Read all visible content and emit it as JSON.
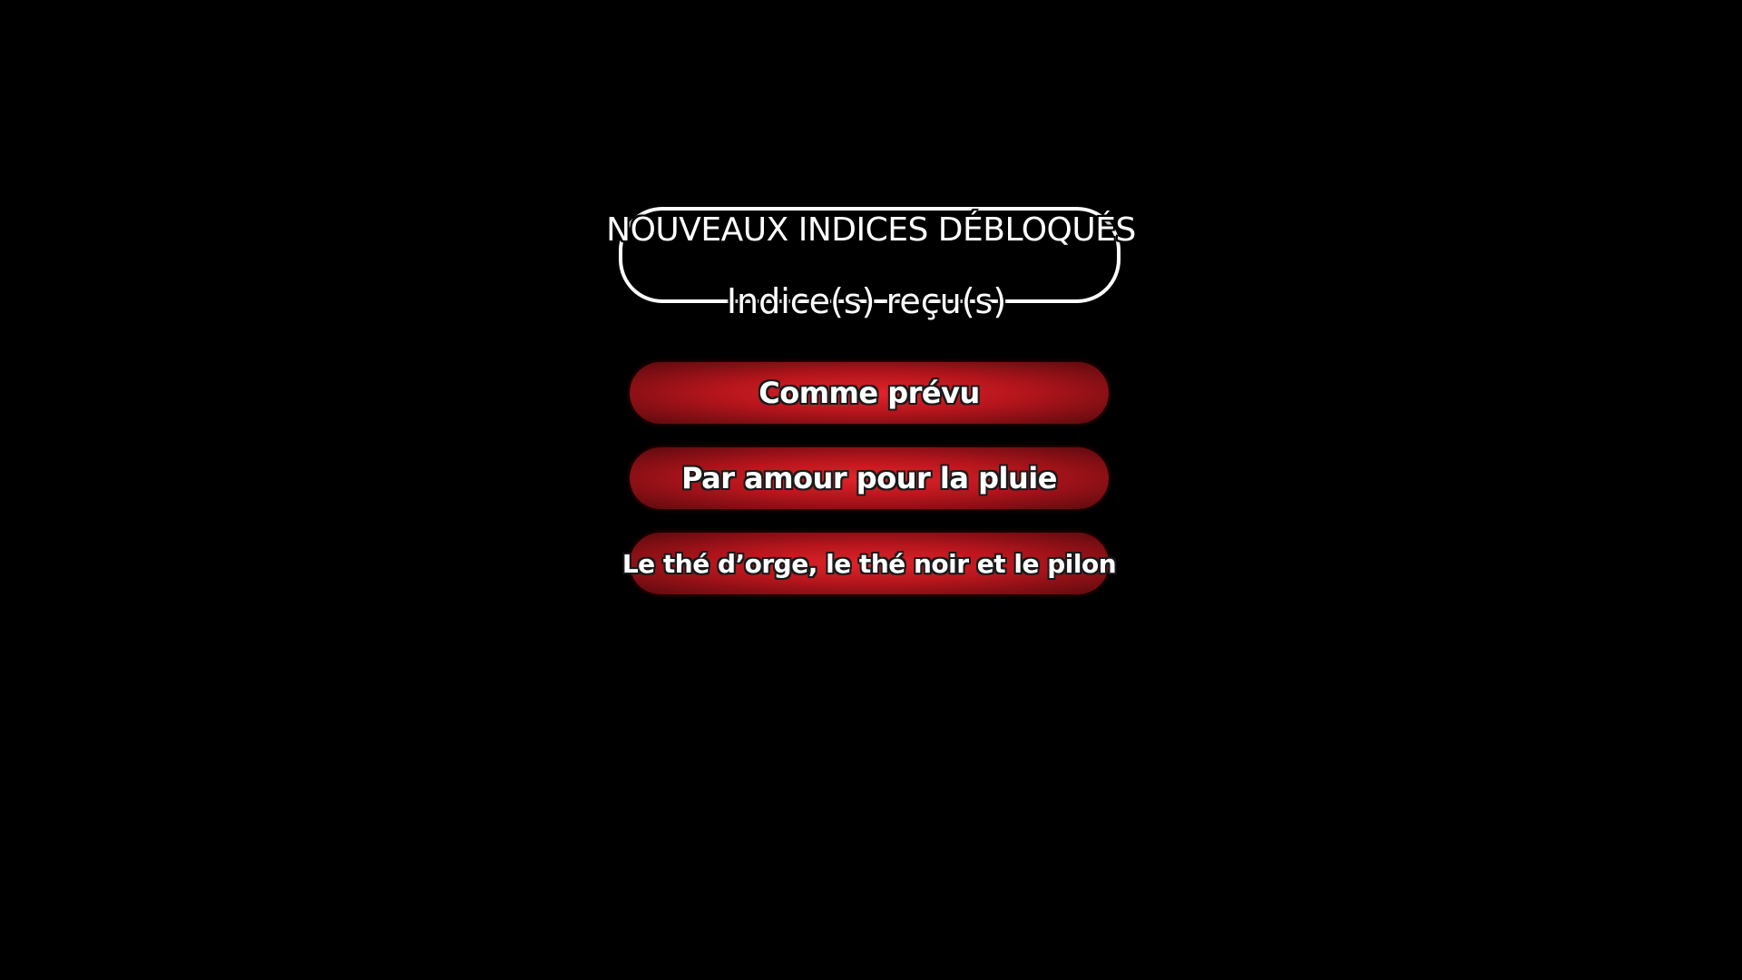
{
  "header": {
    "title": "NOUVEAUX INDICES DÉBLOQUÉS",
    "subtitle": "Indice(s) reçu(s)"
  },
  "clues": [
    {
      "label": "Comme prévu"
    },
    {
      "label": "Par amour pour la pluie"
    },
    {
      "label": "Le thé d’orge, le thé noir et le pilon"
    }
  ],
  "colors": {
    "background": "#000000",
    "button_center": "#e0252b",
    "button_edge": "#5a0a0e",
    "text": "#ffffff"
  }
}
